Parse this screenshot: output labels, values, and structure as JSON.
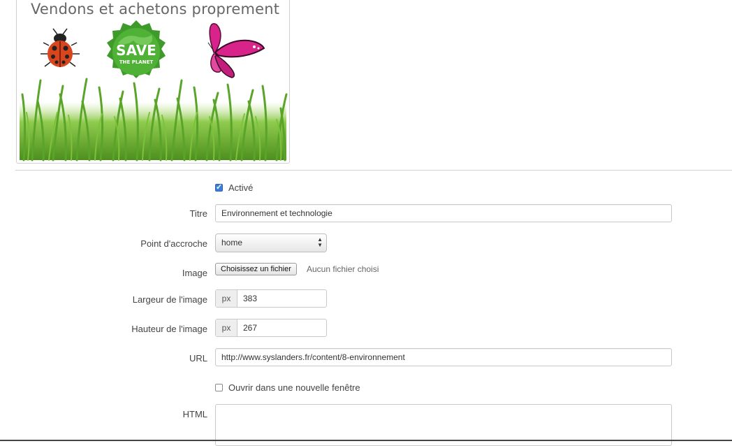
{
  "preview": {
    "banner_text": "Vendons et achetons proprement",
    "badge_text": "SAVE",
    "badge_subtext": "THE PLANET"
  },
  "form": {
    "active": {
      "label": "Activé",
      "checked": true
    },
    "title": {
      "label": "Titre",
      "value": "Environnement et technologie"
    },
    "hook": {
      "label": "Point d'accroche",
      "selected": "home"
    },
    "image": {
      "label": "Image",
      "button": "Choisissez un fichier",
      "status": "Aucun fichier choisi"
    },
    "width": {
      "label": "Largeur de l'image",
      "unit": "px",
      "value": "383"
    },
    "height": {
      "label": "Hauteur de l'image",
      "unit": "px",
      "value": "267"
    },
    "url": {
      "label": "URL",
      "value": "http://www.syslanders.fr/content/8-environnement"
    },
    "new_window": {
      "label": "Ouvrir dans une nouvelle fenêtre",
      "checked": false
    },
    "html": {
      "label": "HTML",
      "value": ""
    }
  },
  "colors": {
    "accent": "#3b7dd8",
    "grass": "#5aa42a",
    "badge": "#3f9a2c",
    "butterfly": "#d8238a",
    "ladybug": "#d9451d"
  }
}
